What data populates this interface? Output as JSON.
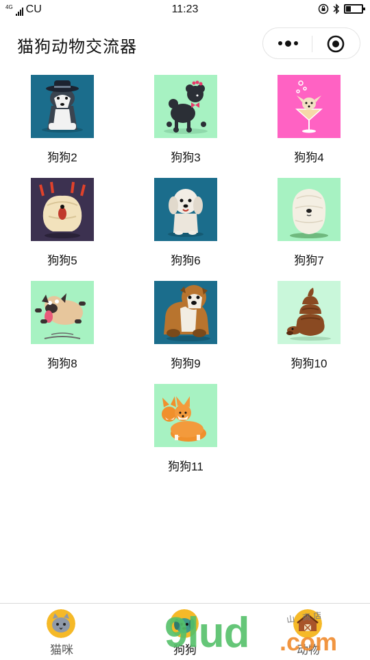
{
  "status_bar": {
    "network": "4G",
    "carrier": "CU",
    "time": "11:23"
  },
  "header": {
    "title": "猫狗动物交流器"
  },
  "dogs": [
    {
      "label": "狗狗2",
      "bg": "#1b6d8c",
      "icon": "husky-with-hat-icon"
    },
    {
      "label": "狗狗3",
      "bg": "#a7f2c2",
      "icon": "poodle-with-bow-icon"
    },
    {
      "label": "狗狗4",
      "bg": "#ff62c3",
      "icon": "chihuahua-in-glass-icon"
    },
    {
      "label": "狗狗5",
      "bg": "#3c3150",
      "icon": "shaggy-dog-barking-icon"
    },
    {
      "label": "狗狗6",
      "bg": "#1b6d8c",
      "icon": "maltese-dog-icon"
    },
    {
      "label": "狗狗7",
      "bg": "#a7f2c2",
      "icon": "fluffy-white-dog-icon"
    },
    {
      "label": "狗狗8",
      "bg": "#a7f2c2",
      "icon": "pug-jumping-icon"
    },
    {
      "label": "狗狗9",
      "bg": "#1b6d8c",
      "icon": "bulldog-icon"
    },
    {
      "label": "狗狗10",
      "bg": "#c9f7da",
      "icon": "dachshund-poop-icon"
    },
    {
      "label": "狗狗11",
      "bg": "#a7f2c2",
      "icon": "corgi-pair-icon"
    }
  ],
  "tabs": [
    {
      "label": "猫咪",
      "icon": "cat-face-icon",
      "active": false
    },
    {
      "label": "狗狗",
      "icon": "dog-face-icon",
      "active": true
    },
    {
      "label": "动物",
      "icon": "barn-icon",
      "active": false
    }
  ],
  "watermark": {
    "main": "9lud",
    "suffix": ".com",
    "small": "山 商店"
  }
}
